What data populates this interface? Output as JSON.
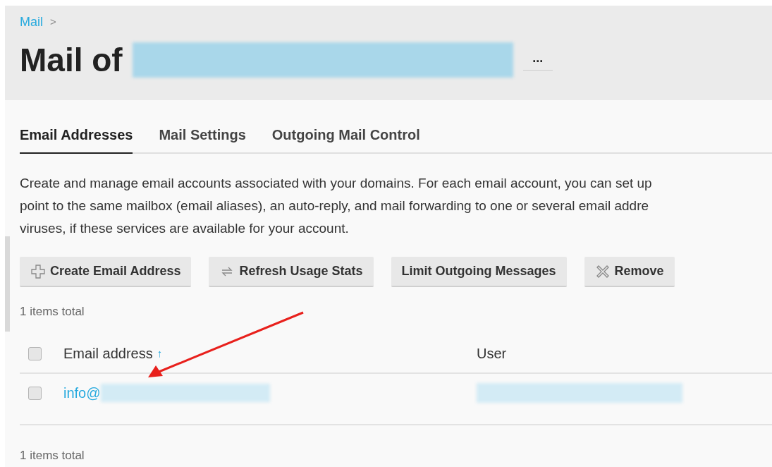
{
  "breadcrumb": [
    {
      "label": "Mail"
    }
  ],
  "breadcrumb_separator": ">",
  "title": {
    "prefix": "Mail of",
    "more_button": "..."
  },
  "tabs": [
    {
      "label": "Email Addresses",
      "selected": true
    },
    {
      "label": "Mail Settings",
      "selected": false
    },
    {
      "label": "Outgoing Mail Control",
      "selected": false
    }
  ],
  "description": [
    "Create and manage email accounts associated with your domains. For each email account, you can set up",
    "point to the same mailbox (email aliases), an auto-reply, and mail forwarding to one or several email addre",
    "viruses, if these services are available for your account."
  ],
  "toolbar": [
    {
      "label": "Create Email Address",
      "kind": "create"
    },
    {
      "label": "Refresh Usage Stats",
      "kind": "refresh"
    },
    {
      "label": "Limit Outgoing Messages",
      "kind": "plain"
    },
    {
      "label": "Remove",
      "kind": "remove"
    }
  ],
  "items_total_top": "1 items total",
  "table": {
    "select_all_checked": false,
    "columns": [
      {
        "label": "Email address",
        "sort": "↑"
      },
      {
        "label": "User"
      }
    ],
    "rows": [
      {
        "email": "info@",
        "checked": false
      }
    ]
  },
  "items_total_bottom": "1 items total"
}
